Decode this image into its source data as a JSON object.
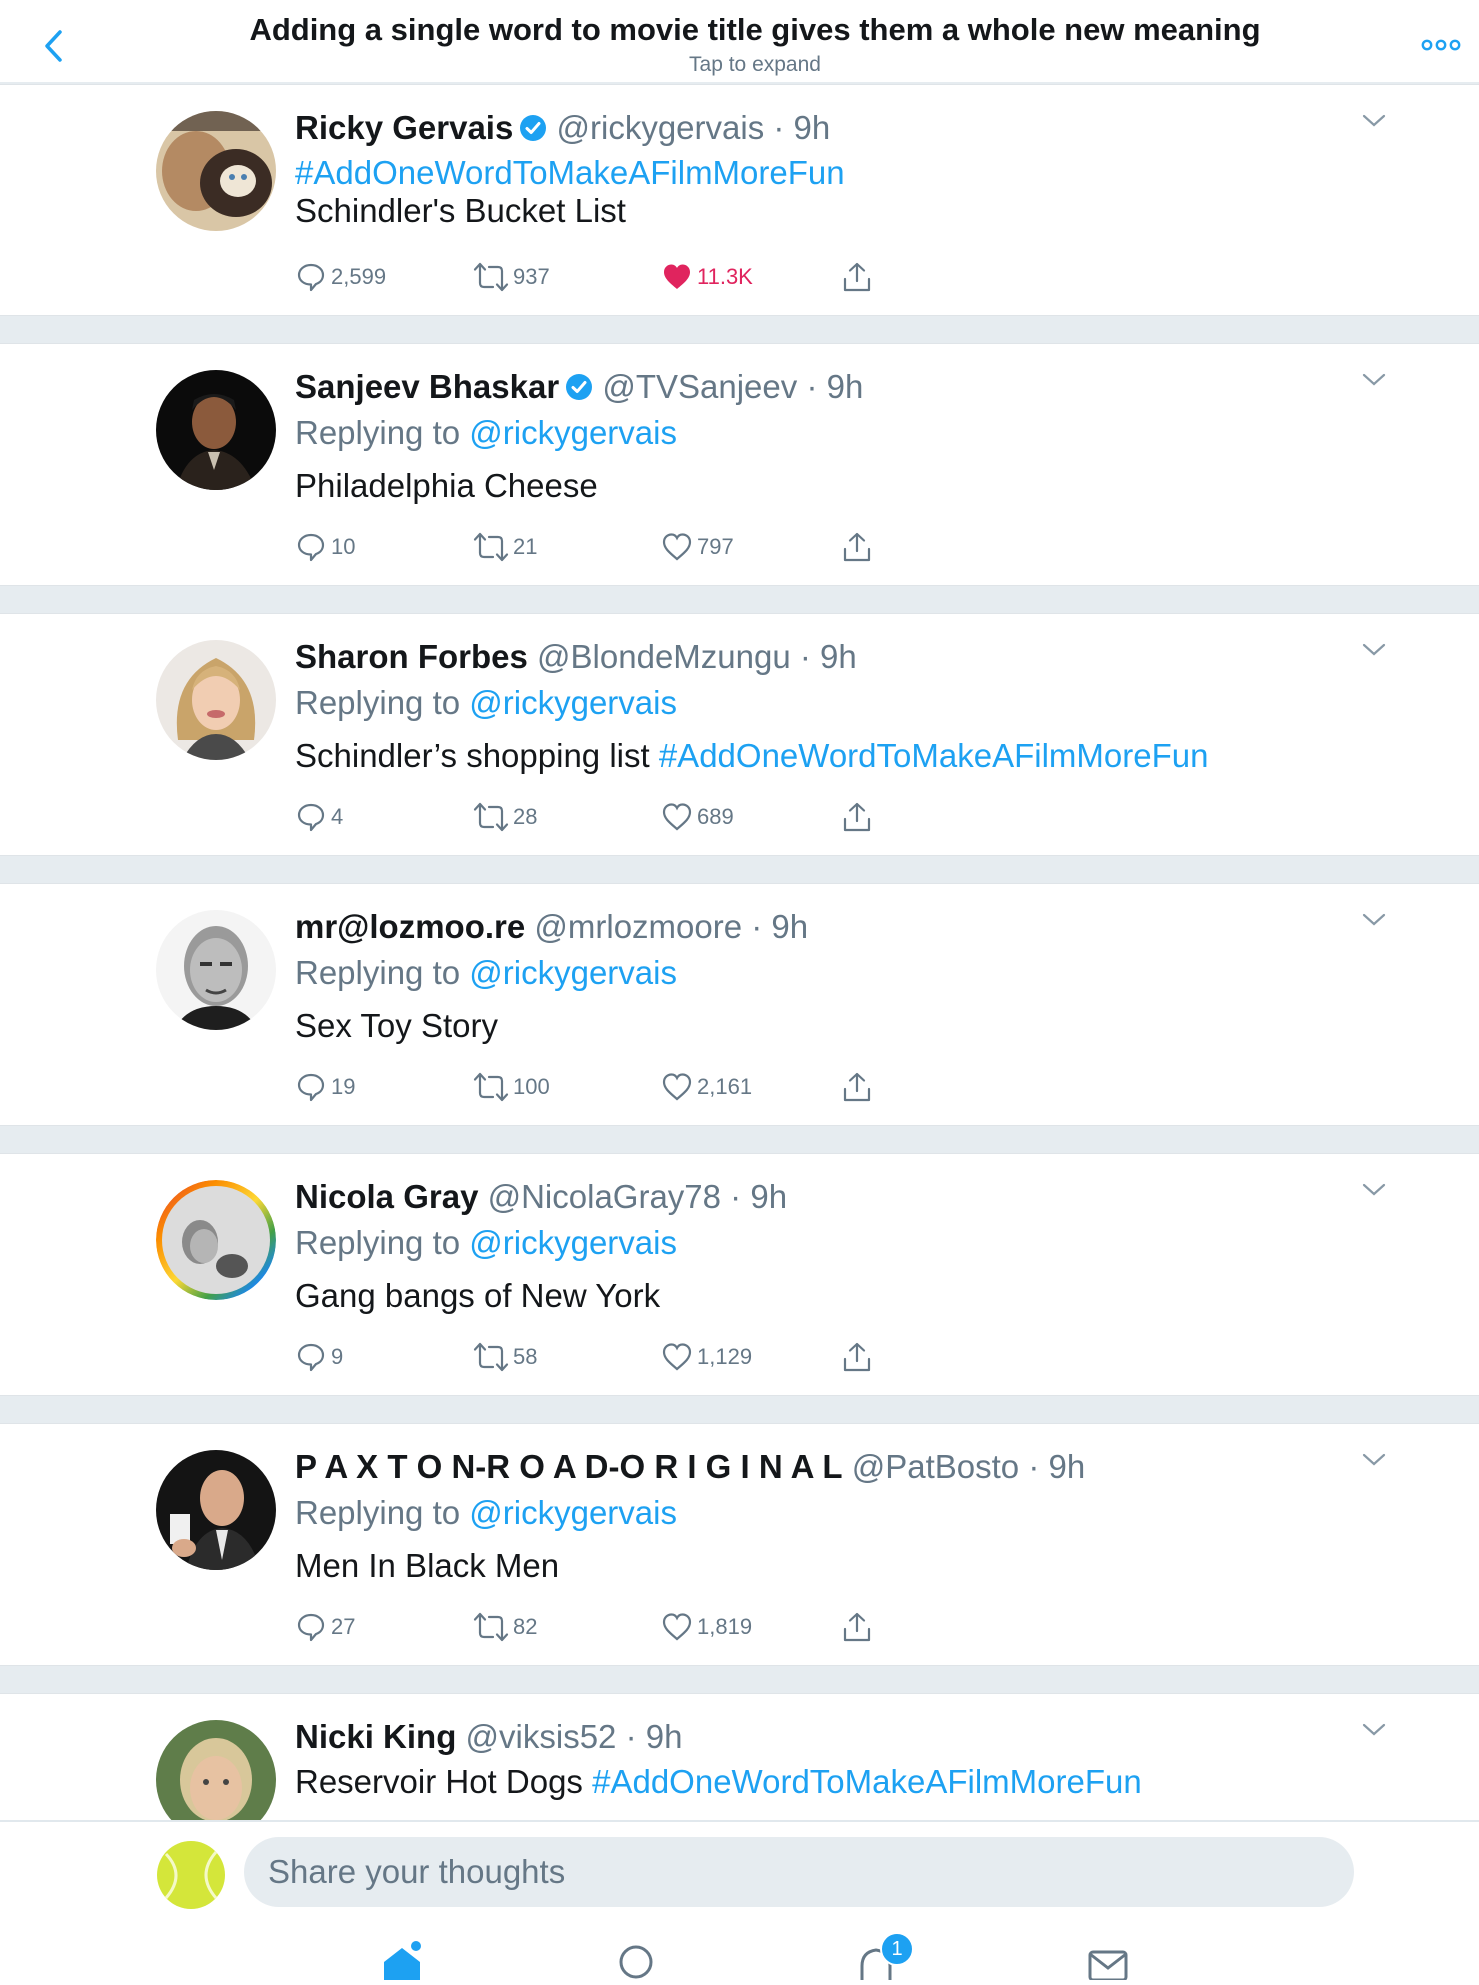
{
  "header": {
    "title": "Adding a single word to movie title gives them a whole new meaning",
    "subtitle": "Tap to expand"
  },
  "tweets": [
    {
      "name": "Ricky Gervais",
      "verified": true,
      "handle": "@rickygervais",
      "time": "9h",
      "reply_prefix": "",
      "reply_to": "",
      "hashtag_line": "#AddOneWordToMakeAFilmMoreFun",
      "text": "Schindler's Bucket List",
      "text_hashtag": "",
      "replies": "2,599",
      "retweets": "937",
      "likes": "11.3K",
      "liked": true
    },
    {
      "name": "Sanjeev Bhaskar",
      "verified": true,
      "handle": "@TVSanjeev",
      "time": "9h",
      "reply_prefix": "Replying to",
      "reply_to": "@rickygervais",
      "text": "Philadelphia Cheese",
      "text_hashtag": "",
      "replies": "10",
      "retweets": "21",
      "likes": "797"
    },
    {
      "name": "Sharon Forbes",
      "handle": "@BlondeMzungu",
      "time": "9h",
      "reply_prefix": "Replying to",
      "reply_to": "@rickygervais",
      "text": "Schindler’s shopping list",
      "text_hashtag": "#AddOneWordToMakeAFilmMoreFun",
      "replies": "4",
      "retweets": "28",
      "likes": "689"
    },
    {
      "name": "mr@lozmoo.re",
      "handle": "@mrlozmoore",
      "time": "9h",
      "reply_prefix": "Replying to",
      "reply_to": "@rickygervais",
      "text": "Sex Toy Story",
      "text_hashtag": "",
      "replies": "19",
      "retweets": "100",
      "likes": "2,161"
    },
    {
      "name": "Nicola Gray",
      "handle": "@NicolaGray78",
      "time": "9h",
      "reply_prefix": "Replying to",
      "reply_to": "@rickygervais",
      "text": "Gang bangs of New York",
      "text_hashtag": "",
      "replies": "9",
      "retweets": "58",
      "likes": "1,129"
    },
    {
      "name": "P A X T O N-R O A D-O R I G I N A L",
      "handle": "@PatBosto",
      "time": "9h",
      "reply_prefix": "Replying to",
      "reply_to": "@rickygervais",
      "text": "Men In Black Men",
      "text_hashtag": "",
      "replies": "27",
      "retweets": "82",
      "likes": "1,819"
    },
    {
      "name": "Nicki King",
      "handle": "@viksis52",
      "time": "9h",
      "text": "Reservoir Hot Dogs",
      "text_hashtag": "#AddOneWordToMakeAFilmMoreFun"
    }
  ],
  "composer": {
    "placeholder": "Share your thoughts"
  },
  "tabbar": {
    "notifications_badge": "1"
  },
  "colors": {
    "accent": "#1da1f2",
    "like": "#e0245e",
    "muted": "#657786",
    "separator": "#e6ecf0"
  }
}
